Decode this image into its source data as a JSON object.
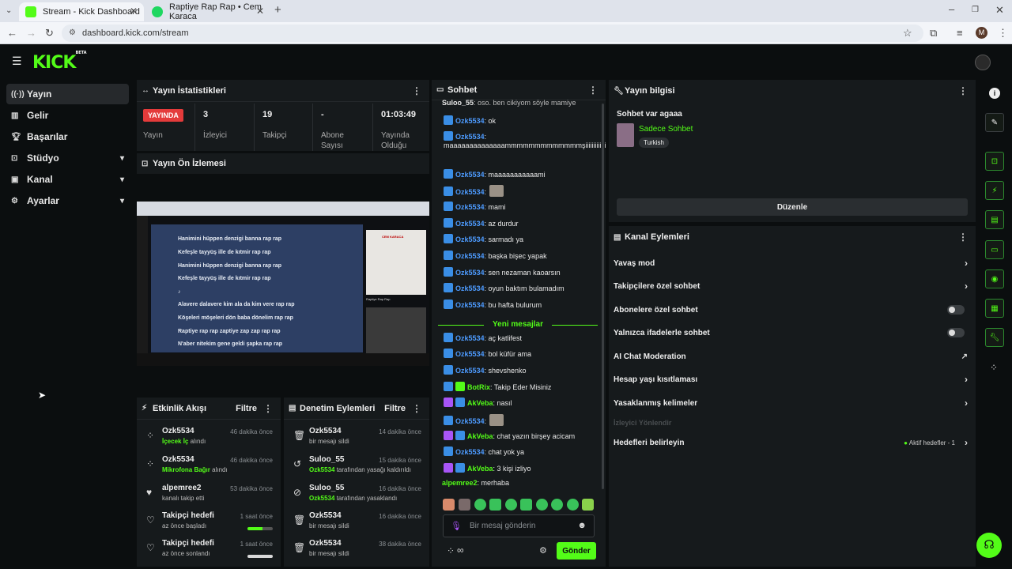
{
  "browser": {
    "tabs": [
      {
        "title": "Stream - Kick Dashboard",
        "favicon_color": "#53fc18",
        "active": true
      },
      {
        "title": "Raptiye Rap Rap • Cem Karaca",
        "favicon_color": "#1ed760",
        "active": false
      }
    ],
    "url": "dashboard.kick.com/stream",
    "profile_initial": "M"
  },
  "brand": {
    "logo": "KICK",
    "logo_tag": "BETA",
    "accent": "#53fc18"
  },
  "sidebar": {
    "items": [
      {
        "label": "Yayın",
        "icon": "broadcast-icon",
        "active": true,
        "expandable": false
      },
      {
        "label": "Gelir",
        "icon": "revenue-icon",
        "active": false,
        "expandable": false
      },
      {
        "label": "Başarılar",
        "icon": "trophy-icon",
        "active": false,
        "expandable": false
      },
      {
        "label": "Stüdyo",
        "icon": "studio-icon",
        "active": false,
        "expandable": true
      },
      {
        "label": "Kanal",
        "icon": "channel-icon",
        "active": false,
        "expandable": true
      },
      {
        "label": "Ayarlar",
        "icon": "gear-icon",
        "active": false,
        "expandable": true
      }
    ]
  },
  "stats": {
    "title": "Yayın İstatistikleri",
    "live_badge": "YAYINDA",
    "live_label": "Yayın",
    "items": [
      {
        "value": "3",
        "label": "İzleyici"
      },
      {
        "value": "19",
        "label": "Takipçi"
      },
      {
        "value": "-",
        "label": "Abone Sayısı"
      },
      {
        "value": "01:03:49",
        "label": "Yayında Olduğu Sü"
      }
    ]
  },
  "preview": {
    "title": "Yayın Ön İzlemesi",
    "lyrics": [
      "Hanimini hüppen denzigi banna rap rap",
      "Kefeşle tayyüş ille de kıtmir rap rap",
      "Hanimini hüppen denzigi banna rap rap",
      "Kefeşle tayyüş ille de kıtmir rap rap",
      "♪",
      "Alavere dalavere kim ala da kim vere rap rap",
      "Köşeleri möşeleri dön baba dönelim rap rap",
      "Raptiye rap rap zaptiye zap zap rap rap",
      "N'aber nitekim gene geldi şapka rap rap"
    ],
    "album_text": "CEM KARACA",
    "song_title": "Raptiye Rap Rap"
  },
  "activity": {
    "title": "Etkinlik Akışı",
    "filter_label": "Filtre",
    "items": [
      {
        "icon": "user-dots-icon",
        "name": "Ozk5534",
        "highlight": "İçecek İç",
        "detail": " alındı",
        "time": "46 dakika önce"
      },
      {
        "icon": "user-dots-icon",
        "name": "Ozk5534",
        "highlight": "Mikrofona Bağır",
        "detail": " alındı",
        "time": "46 dakika önce"
      },
      {
        "icon": "heart-filled-icon",
        "name": "alpemree2",
        "highlight": "",
        "detail": "kanalı takip etti",
        "time": "53 dakika önce"
      },
      {
        "icon": "heart-outline-icon",
        "name": "Takipçi hedefi",
        "highlight": "",
        "detail": "az önce başladı",
        "time": "1 saat önce",
        "progress": 0.6
      },
      {
        "icon": "heart-outline-icon",
        "name": "Takipçi hedefi",
        "highlight": "",
        "detail": "az önce sonlandı",
        "time": "1 saat önce",
        "progress": 1.0
      }
    ]
  },
  "moderation": {
    "title": "Denetim Eylemleri",
    "filter_label": "Filtre",
    "items": [
      {
        "icon": "trash-icon",
        "name": "Ozk5534",
        "highlight": "",
        "detail": "bir mesajı sildi",
        "time": "14 dakika önce"
      },
      {
        "icon": "undo-icon",
        "name": "Suloo_55",
        "highlight": "Ozk5534",
        "detail": " tarafından yasağı kaldırıldı",
        "time": "15 dakika önce"
      },
      {
        "icon": "ban-icon",
        "name": "Suloo_55",
        "highlight": "Ozk5534",
        "detail": " tarafından yasaklandı",
        "time": "16 dakika önce"
      },
      {
        "icon": "trash-icon",
        "name": "Ozk5534",
        "highlight": "",
        "detail": "bir mesajı sildi",
        "time": "16 dakika önce"
      },
      {
        "icon": "trash-icon",
        "name": "Ozk5534",
        "highlight": "",
        "detail": "bir mesajı sildi",
        "time": "38 dakika önce"
      }
    ]
  },
  "chat": {
    "title": "Sohbet",
    "new_messages": "Yeni mesajlar",
    "input_placeholder": "Bir mesaj gönderin",
    "send_label": "Gönder",
    "messages": [
      {
        "user": "Suloo_55",
        "color": "#e8e8e8",
        "badge": "",
        "text": ": oso. ben cikiyom söyle mamiye"
      },
      {
        "user": "Ozk5534",
        "color": "#4d9bff",
        "badge": "#3a8ee6",
        "text": ": ok"
      },
      {
        "user": "Ozk5534",
        "color": "#4d9bff",
        "badge": "#3a8ee6",
        "text": ": maaaaaaaaaaaaaammmmmmmmmmmmmşiiiiiiiiiiiii"
      },
      {
        "user": "Ozk5534",
        "color": "#4d9bff",
        "badge": "#3a8ee6",
        "text": ": maaaaaaaaaaami"
      },
      {
        "user": "Ozk5534",
        "color": "#4d9bff",
        "badge": "#3a8ee6",
        "text": ":",
        "emote": true
      },
      {
        "user": "Ozk5534",
        "color": "#4d9bff",
        "badge": "#3a8ee6",
        "text": ": mami"
      },
      {
        "user": "Ozk5534",
        "color": "#4d9bff",
        "badge": "#3a8ee6",
        "text": ": az durdur"
      },
      {
        "user": "Ozk5534",
        "color": "#4d9bff",
        "badge": "#3a8ee6",
        "text": ": sarmadı ya"
      },
      {
        "user": "Ozk5534",
        "color": "#4d9bff",
        "badge": "#3a8ee6",
        "text": ": başka bişec yapak"
      },
      {
        "user": "Ozk5534",
        "color": "#4d9bff",
        "badge": "#3a8ee6",
        "text": ": sen nezaman kaoarsın"
      },
      {
        "user": "Ozk5534",
        "color": "#4d9bff",
        "badge": "#3a8ee6",
        "text": ": oyun baktım bulamadım"
      },
      {
        "user": "Ozk5534",
        "color": "#4d9bff",
        "badge": "#3a8ee6",
        "text": ": bu hafta bulurum"
      },
      {
        "user": "Ozk5534",
        "color": "#4d9bff",
        "badge": "#3a8ee6",
        "text": ": aç katlifest"
      },
      {
        "user": "Ozk5534",
        "color": "#4d9bff",
        "badge": "#3a8ee6",
        "text": ": bol küfür ama"
      },
      {
        "user": "Ozk5534",
        "color": "#4d9bff",
        "badge": "#3a8ee6",
        "text": ": shevshenko"
      },
      {
        "user": "BotRix",
        "color": "#53fc18",
        "badge": "#3a8ee6",
        "badge2": "#53fc18",
        "text": ": Takip Eder Misiniz"
      },
      {
        "user": "AkVeba",
        "color": "#53fc18",
        "badge": "#a855f7",
        "badge2": "#3a8ee6",
        "text": ": nasıl"
      },
      {
        "user": "Ozk5534",
        "color": "#4d9bff",
        "badge": "#3a8ee6",
        "text": ":",
        "emote": true
      },
      {
        "user": "AkVeba",
        "color": "#53fc18",
        "badge": "#a855f7",
        "badge2": "#3a8ee6",
        "text": ": chat yazın birşey acicam"
      },
      {
        "user": "Ozk5534",
        "color": "#4d9bff",
        "badge": "#3a8ee6",
        "text": ": chat yok ya"
      },
      {
        "user": "AkVeba",
        "color": "#53fc18",
        "badge": "#a855f7",
        "badge2": "#3a8ee6",
        "text": ": 3 kişi izliyo"
      },
      {
        "user": "alpemree2",
        "color": "#53fc18",
        "badge": "",
        "text": ": merhaba"
      }
    ]
  },
  "stream_info": {
    "title": "Yayın bilgisi",
    "stream_title": "Sohbet var agaaa",
    "category": "Sadece Sohbet",
    "language_tag": "Turkish",
    "edit_label": "Düzenle"
  },
  "channel_actions": {
    "title": "Kanal Eylemleri",
    "rows": [
      {
        "label": "Yavaş mod",
        "control": "chevron"
      },
      {
        "label": "Takipçilere özel sohbet",
        "control": "chevron"
      },
      {
        "label": "Abonelere özel sohbet",
        "control": "toggle"
      },
      {
        "label": "Yalnızca ifadelerle sohbet",
        "control": "toggle"
      },
      {
        "label": "AI Chat Moderation",
        "control": "external"
      },
      {
        "label": "Hesap yaşı kısıtlaması",
        "control": "chevron"
      },
      {
        "label": "Yasaklanmış kelimeler",
        "control": "chevron"
      },
      {
        "label": "İzleyici Yönlendir",
        "control": "disabled"
      },
      {
        "label": "Hedefleri belirleyin",
        "control": "chevron",
        "extra": "Aktif hedefler - 1"
      }
    ]
  }
}
